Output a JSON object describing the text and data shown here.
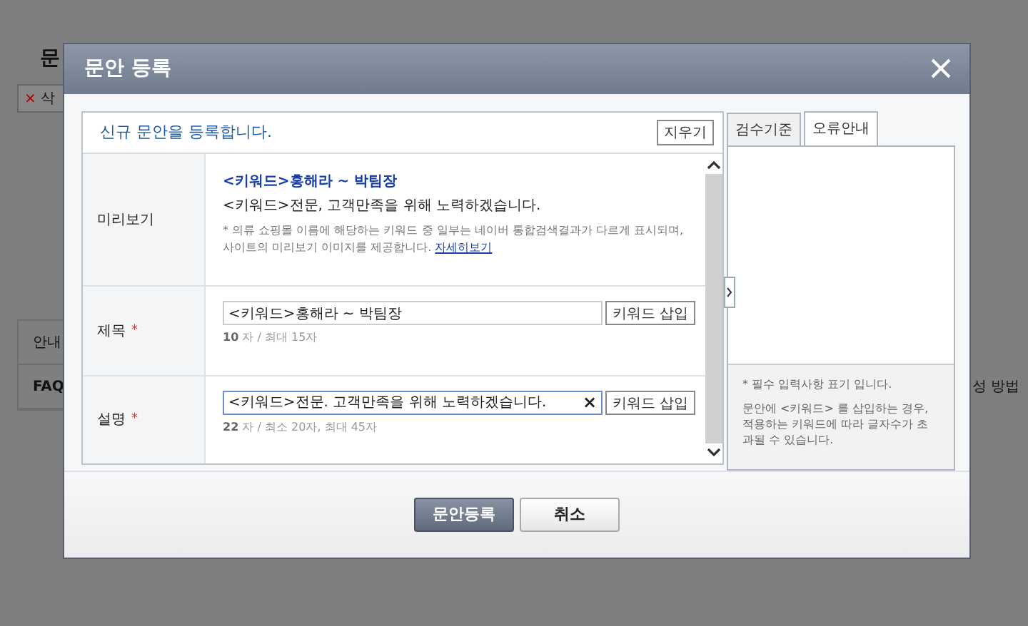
{
  "background": {
    "heading": "문",
    "delete_button": "삭",
    "delete_mark": "×",
    "section_label": "안내",
    "faq": "FAQ",
    "side_text": "성 방법"
  },
  "dialog": {
    "title": "문안 등록",
    "intro": "신규 문안을 등록합니다.",
    "clear_button": "지우기",
    "preview": {
      "label": "미리보기",
      "title": "<키워드>홍해라 ~ 박팀장",
      "description": "<키워드>전문, 고객만족을 위해 노력하겠습니다.",
      "note": "* 의류 쇼핑몰 이름에 해당하는 키워드 중 일부는 네이버 통합검색결과가 다르게 표시되며, 사이트의 미리보기 이미지를 제공합니다.",
      "link": "자세히보기"
    },
    "fields": [
      {
        "label": "제목",
        "required": true,
        "required_mark": "*",
        "value": "<키워드>홍해라 ~ 박팀장",
        "focused": false,
        "insert_button": "키워드 삽입",
        "count": "10",
        "limit": "자 / 최대 15자"
      },
      {
        "label": "설명",
        "required": true,
        "required_mark": "*",
        "value": "<키워드>전문. 고객만족을 위해 노력하겠습니다.",
        "focused": true,
        "clear_mark": "×",
        "insert_button": "키워드 삽입",
        "count": "22",
        "limit": "자 / 최소 20자, 최대 45자"
      }
    ],
    "tabs": [
      {
        "label": "검수기준",
        "selected": false
      },
      {
        "label": "오류안내",
        "selected": true
      }
    ],
    "help_notes": [
      "* 필수 입력사항 표기 입니다.",
      "문안에 <키워드> 를 삽입하는 경우, 적용하는 키워드에 따라 글자수가 초과될 수 있습니다."
    ],
    "buttons": [
      {
        "label": "문안등록",
        "kind": "primary"
      },
      {
        "label": "취소",
        "kind": "secondary"
      }
    ]
  }
}
